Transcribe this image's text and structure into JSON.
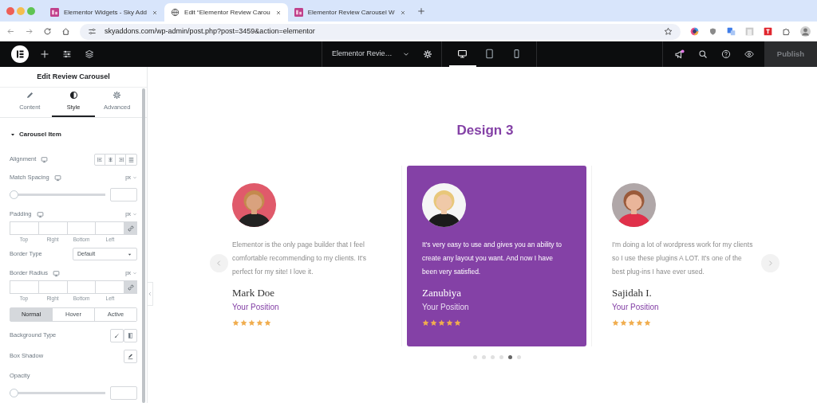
{
  "browser": {
    "tabs": [
      {
        "title": "Elementor Widgets - Sky Add",
        "selected": false
      },
      {
        "title": "Edit “Elementor Review Carou",
        "selected": true
      },
      {
        "title": "Elementor Review Carousel W",
        "selected": false
      }
    ],
    "url": "skyaddons.com/wp-admin/post.php?post=3459&action=elementor"
  },
  "editor_bar": {
    "document": "Elementor Revie…",
    "devices": [
      {
        "kind": "desktop",
        "selected": true
      },
      {
        "kind": "tablet",
        "selected": false
      },
      {
        "kind": "phone",
        "selected": false
      }
    ],
    "notification": true,
    "publish": {
      "label": "Publish",
      "disabled": true
    }
  },
  "panel": {
    "title": "Edit Review Carousel",
    "tabs": [
      {
        "label": "Content",
        "selected": false
      },
      {
        "label": "Style",
        "selected": true
      },
      {
        "label": "Advanced",
        "selected": false
      }
    ],
    "section": {
      "title": "Carousel Item",
      "expanded": true
    },
    "controls": [
      {
        "kind": "align",
        "label": "Alignment",
        "responsive": true
      },
      {
        "kind": "slider",
        "label": "Match Spacing",
        "responsive": true,
        "unit": "px",
        "level": 0
      },
      {
        "kind": "dimensions",
        "label": "Padding",
        "responsive": true,
        "unit": "px",
        "sides": [
          "Top",
          "Right",
          "Bottom",
          "Left"
        ]
      },
      {
        "kind": "select",
        "label": "Border Type",
        "value": "Default"
      },
      {
        "kind": "dimensions",
        "label": "Border Radius",
        "responsive": true,
        "unit": "px",
        "sides": [
          "Top",
          "Right",
          "Bottom",
          "Left"
        ]
      },
      {
        "kind": "states",
        "options": [
          {
            "label": "Normal",
            "selected": true
          },
          {
            "label": "Hover",
            "selected": false
          },
          {
            "label": "Active",
            "selected": false
          }
        ]
      },
      {
        "kind": "choose",
        "label": "Background Type"
      },
      {
        "kind": "popover",
        "label": "Box Shadow"
      },
      {
        "kind": "slider",
        "label": "Opacity",
        "responsive": false,
        "level": 0
      }
    ]
  },
  "canvas": {
    "heading": "Design 3",
    "reviews": [
      {
        "text": "Elementor is the only page builder that I feel comfortable recommending to my clients. It's perfect for my site! I love it.",
        "name": "Mark Doe",
        "position": "Your Position",
        "stars": 5,
        "highlighted": false
      },
      {
        "text": "It's very easy to use and gives you an ability to create any layout you want. And now I have been very satisfied.",
        "name": "Zanubiya",
        "position": "Your Position",
        "stars": 5,
        "highlighted": true
      },
      {
        "text": "I'm doing a lot of wordpress work for my clients so I use these plugins A LOT. It's one of the best plug-ins I have ever used.",
        "name": "Sajidah I.",
        "position": "Your Position",
        "stars": 5,
        "highlighted": false
      }
    ],
    "dots": [
      {
        "selected": false
      },
      {
        "selected": false
      },
      {
        "selected": false
      },
      {
        "selected": false
      },
      {
        "selected": true
      },
      {
        "selected": false
      }
    ]
  }
}
